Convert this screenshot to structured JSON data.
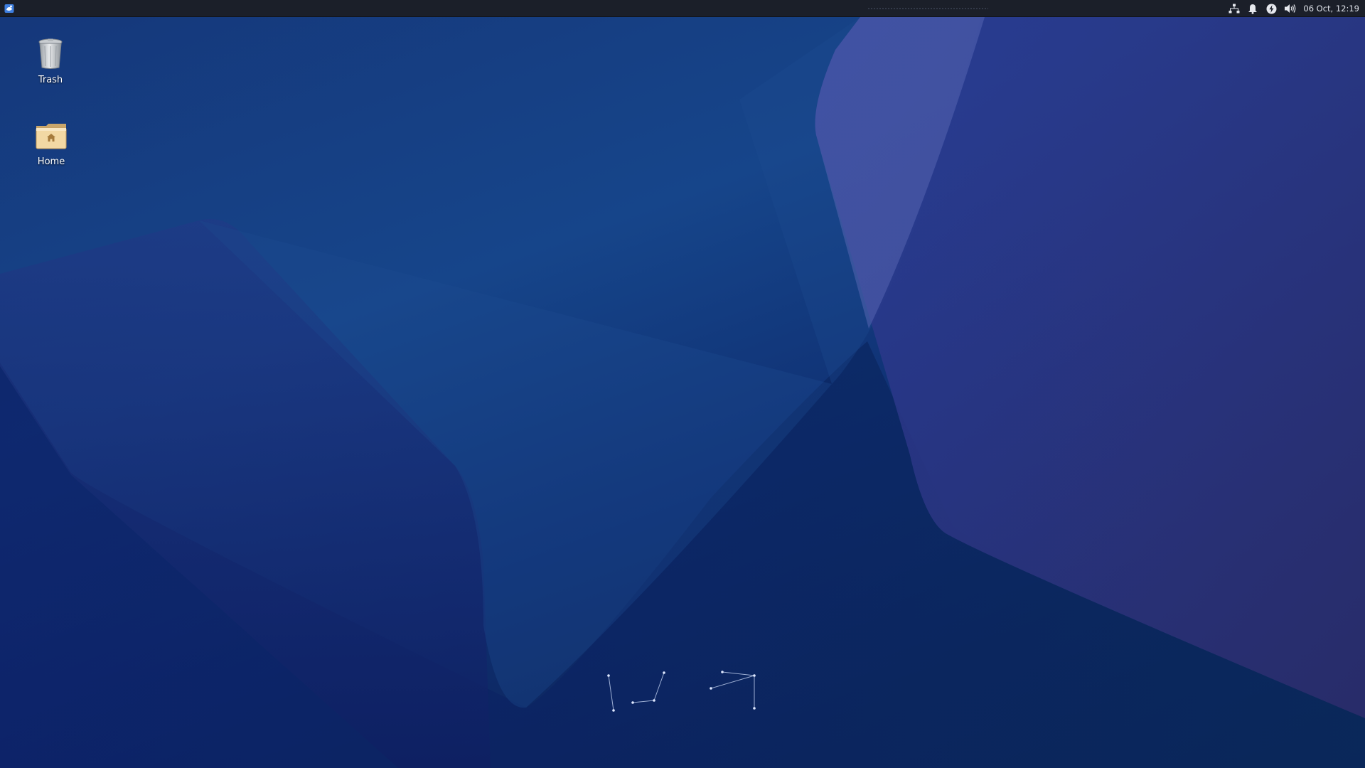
{
  "panel": {
    "menu_button_icon": "xfce-mouse-icon",
    "tray_icons": [
      "network-wired-icon",
      "notification-bell-icon",
      "power-manager-icon",
      "volume-icon"
    ],
    "clock": "06 Oct, 12:19"
  },
  "desktop": {
    "icons": [
      {
        "label": "Trash",
        "icon": "trash-can-icon"
      },
      {
        "label": "Home",
        "icon": "home-folder-icon"
      }
    ]
  },
  "colors": {
    "panel_bg": "#1b1f29",
    "wallpaper_base": "#16458a",
    "wallpaper_dark": "#0a1f4c",
    "shape_violet": "#3a4fa0"
  }
}
